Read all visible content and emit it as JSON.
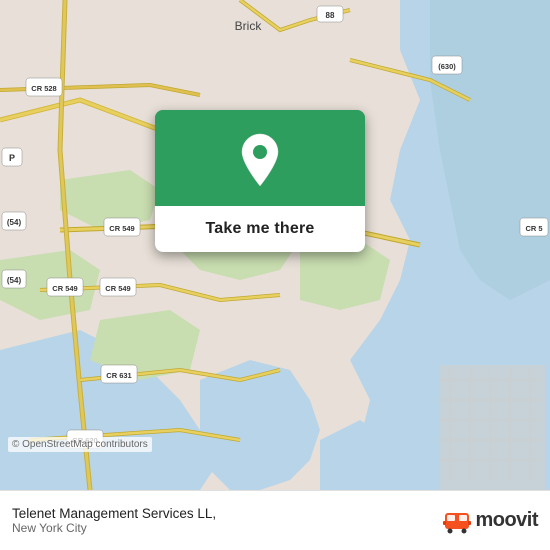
{
  "map": {
    "copyright": "© OpenStreetMap contributors",
    "background_color": "#e8e0d8"
  },
  "popup": {
    "button_label": "Take me there",
    "pin_color": "#ffffff"
  },
  "bottom_bar": {
    "location_name": "Telenet Management Services LL,",
    "location_city": "New York City",
    "brand_name": "moovit"
  }
}
